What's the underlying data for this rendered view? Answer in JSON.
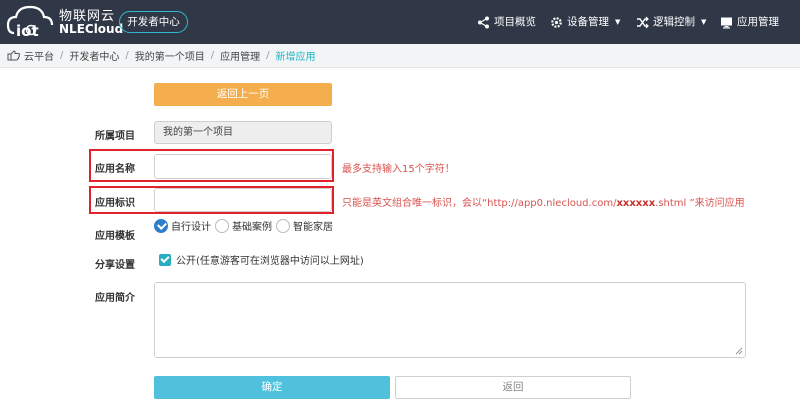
{
  "header": {
    "brand_cn": "物联网云",
    "brand_en": "NLECloud",
    "logo_text": "iot",
    "dev_center": "开发者中心",
    "nav": [
      {
        "label": "项目概览",
        "icon": "share-icon"
      },
      {
        "label": "设备管理",
        "icon": "gear-icon",
        "dropdown": true
      },
      {
        "label": "逻辑控制",
        "icon": "shuffle-icon",
        "dropdown": true
      },
      {
        "label": "应用管理",
        "icon": "monitor-icon"
      }
    ]
  },
  "breadcrumb": [
    "云平台",
    "开发者中心",
    "我的第一个项目",
    "应用管理",
    "新增应用"
  ],
  "form": {
    "back_button": "返回上一页",
    "project_label": "所属项目",
    "project_value": "我的第一个项目",
    "app_name_label": "应用名称",
    "app_name_value": "",
    "app_name_hint": "最多支持输入15个字符！",
    "app_id_label": "应用标识",
    "app_id_value": "",
    "app_id_hint_prefix": "只能是英文组合唯一标识，会以“http://app0.nlecloud.com/",
    "app_id_hint_bold": "xxxxxx",
    "app_id_hint_suffix": ".shtml ”来访问应用",
    "template_label": "应用模板",
    "templates": [
      {
        "label": "自行设计",
        "selected": true
      },
      {
        "label": "基础案例",
        "selected": false
      },
      {
        "label": "智能家居",
        "selected": false
      }
    ],
    "share_label": "分享设置",
    "share_option": "公开(任意游客可在浏览器中访问以上网址)",
    "share_checked": true,
    "intro_label": "应用简介",
    "intro_value": "",
    "confirm_button": "确定",
    "return_button": "返回"
  },
  "colors": {
    "header_bg": "#303848",
    "accent": "#20b6c4",
    "back_button": "#f4ae4e",
    "confirm_button": "#4fc1dc",
    "highlight": "#e0232a"
  }
}
